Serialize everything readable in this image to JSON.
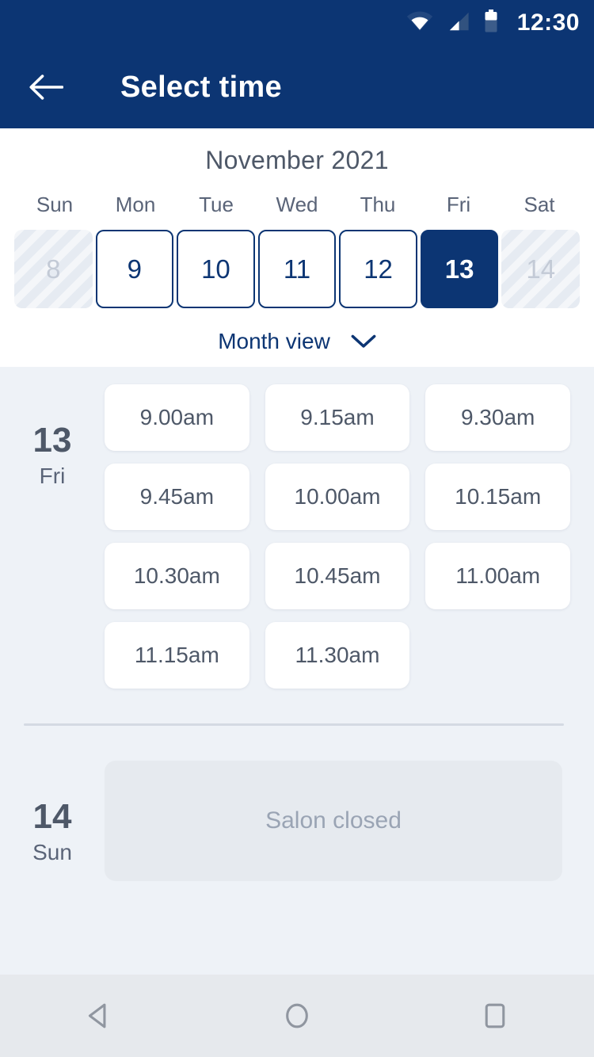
{
  "status_bar": {
    "time": "12:30",
    "icons": [
      "wifi-icon",
      "signal-icon",
      "battery-icon"
    ]
  },
  "app_bar": {
    "back_icon": "back-arrow-icon",
    "title": "Select time"
  },
  "calendar": {
    "month_title": "November 2021",
    "weekday_headers": [
      "Sun",
      "Mon",
      "Tue",
      "Wed",
      "Thu",
      "Fri",
      "Sat"
    ],
    "days": [
      {
        "number": "8",
        "state": "disabled"
      },
      {
        "number": "9",
        "state": "enabled"
      },
      {
        "number": "10",
        "state": "enabled"
      },
      {
        "number": "11",
        "state": "enabled"
      },
      {
        "number": "12",
        "state": "enabled"
      },
      {
        "number": "13",
        "state": "selected"
      },
      {
        "number": "14",
        "state": "disabled"
      }
    ],
    "view_toggle_label": "Month view",
    "view_toggle_icon": "chevron-down-icon"
  },
  "schedule": [
    {
      "day_number": "13",
      "day_name": "Fri",
      "slots": [
        "9.00am",
        "9.15am",
        "9.30am",
        "9.45am",
        "10.00am",
        "10.15am",
        "10.30am",
        "10.45am",
        "11.00am",
        "11.15am",
        "11.30am"
      ]
    },
    {
      "day_number": "14",
      "day_name": "Sun",
      "closed_message": "Salon closed"
    }
  ],
  "nav_bar": {
    "back": "android-back-icon",
    "home": "android-home-icon",
    "recents": "android-recents-icon"
  },
  "colors": {
    "brand_navy": "#0c3573",
    "content_bg": "#eef2f7",
    "text_slate": "#4e5868",
    "muted": "#9aa4b4"
  }
}
